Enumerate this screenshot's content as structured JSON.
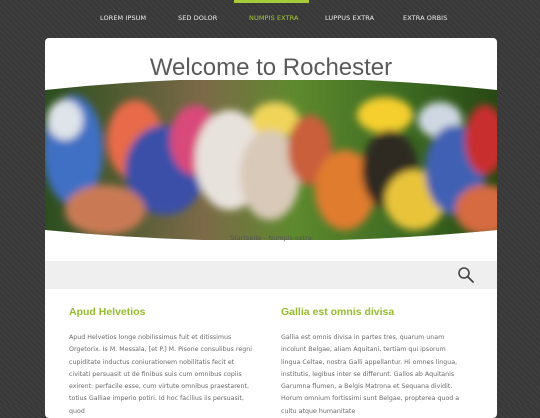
{
  "nav": {
    "items": [
      {
        "label": "LOREM IPSUM"
      },
      {
        "label": "SED DOLOR"
      },
      {
        "label": "NUMPIS EXTRA",
        "active": true
      },
      {
        "label": "LUPPUS EXTRA"
      },
      {
        "label": "EXTRA ORBIS"
      }
    ]
  },
  "page": {
    "title": "Welcome to Rochester",
    "breadcrumb": "Startseite - Numpis extra"
  },
  "search": {
    "icon": "search-icon"
  },
  "columns": [
    {
      "heading": "Apud Helvetios",
      "text": "Apud Helvetios longe nobilissimus fuit et ditissimus Orgetorix. Is M. Messala, [et P.] M. Pisone consulibus regni cupiditate inductus coniurationem nobilitatis fecit et civitati persuasit ut de finibus suis cum omnibus copiis exirent: perfacile esse, cum virtute omnibus praestarent, totius Galliae imperio potiri. Id hoc facilius iis persuasit, quod"
    },
    {
      "heading": "Gallia est omnis divisa",
      "text": "Gallia est omnis divisa in partes tres, quarum unam incolunt Belgae, aliam Aquitani, tertiam qui ipsorum lingua Celtae, nostra Galli appellantur. Hi omnes lingua, institutis, legibus inter se differunt. Gallos ab Aquitanis Garumna flumen, a Belgis Matrona et Sequana dividit. Horum omnium fortissimi sunt Belgae, propterea quod a cultu atque humanitate"
    }
  ],
  "colors": {
    "accent": "#a6cc3a",
    "heading": "#96bd2c",
    "background": "#3a3a3a",
    "card": "#ffffff"
  }
}
